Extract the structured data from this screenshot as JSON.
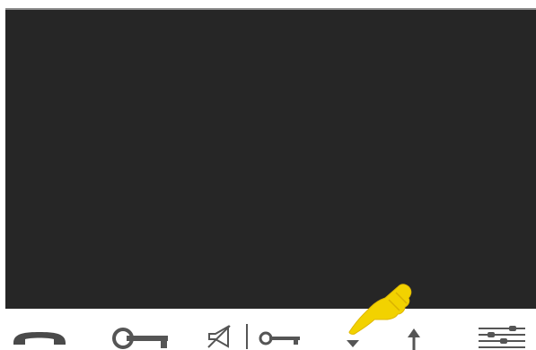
{
  "screen": {
    "state": "video-off",
    "background": "#262626"
  },
  "toolbar": {
    "icon_color": "#555555",
    "buttons": [
      {
        "id": "hang-up",
        "icon": "handset-icon"
      },
      {
        "id": "door-open",
        "icon": "key-icon"
      },
      {
        "id": "mute-door-open",
        "icon": "speaker-muted-key-icon"
      },
      {
        "id": "scroll-down",
        "icon": "arrow-down-icon"
      },
      {
        "id": "scroll-up",
        "icon": "arrow-up-icon"
      },
      {
        "id": "menu",
        "icon": "sliders-menu-icon"
      }
    ]
  },
  "pointer": {
    "icon": "pointing-hand-icon",
    "color": "#f2d200",
    "target": "scroll-down"
  }
}
